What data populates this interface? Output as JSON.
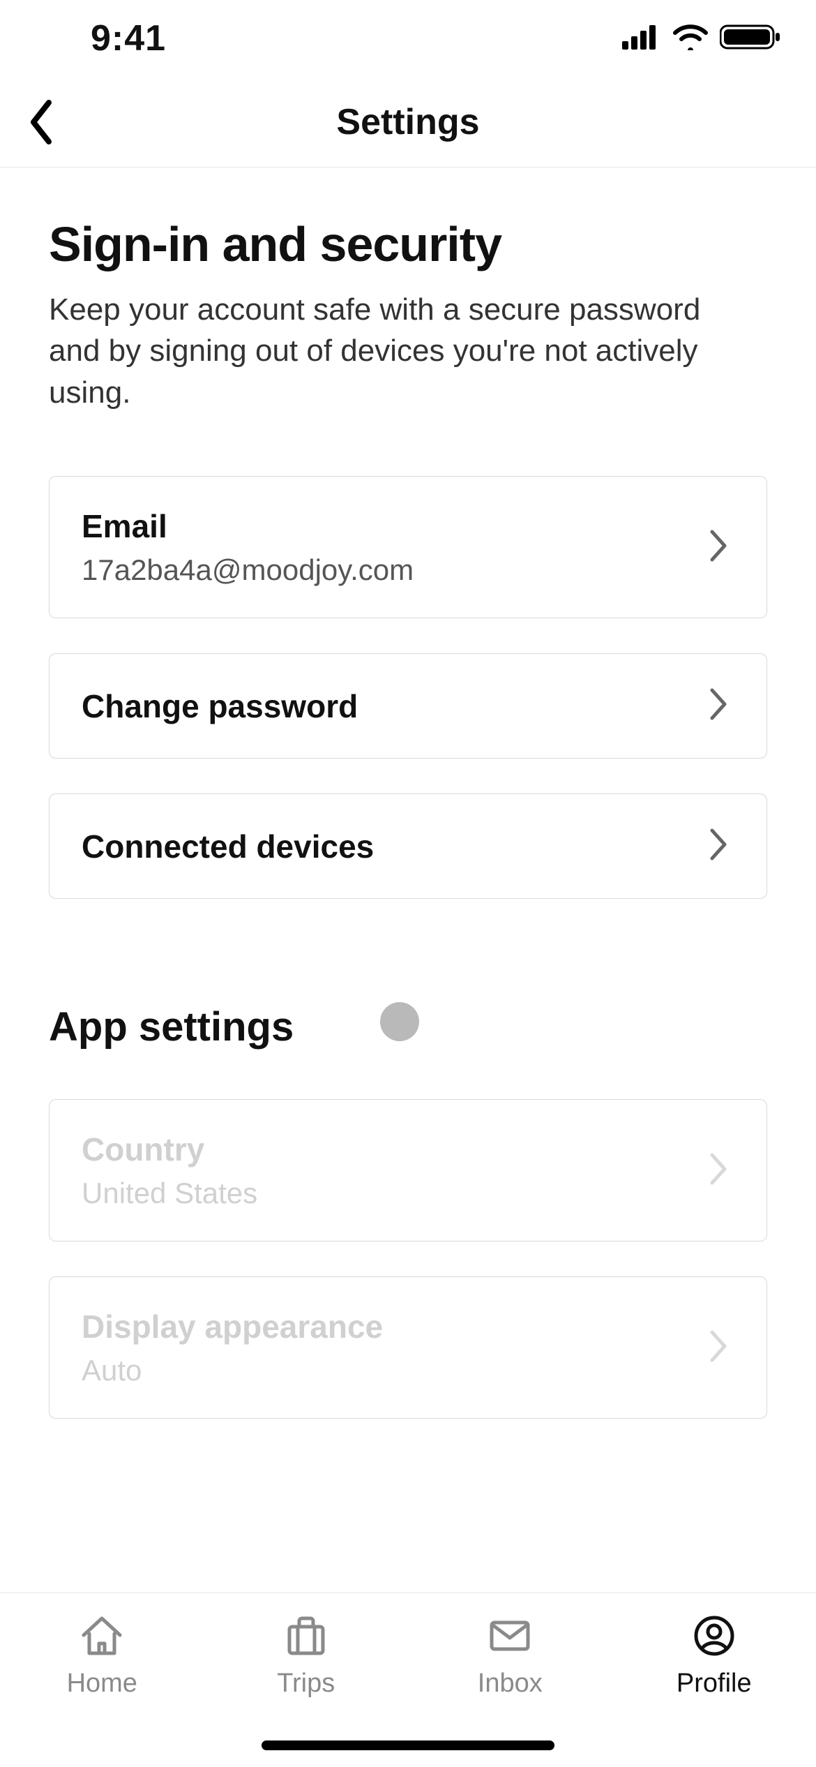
{
  "status": {
    "time": "9:41"
  },
  "header": {
    "title": "Settings"
  },
  "section1": {
    "title": "Sign-in and security",
    "description": "Keep your account safe with a secure password and by signing out of devices you're not actively using."
  },
  "cards": {
    "email": {
      "title": "Email",
      "value": "17a2ba4a@moodjoy.com"
    },
    "password": {
      "title": "Change password"
    },
    "devices": {
      "title": "Connected devices"
    }
  },
  "section2": {
    "title": "App settings"
  },
  "app_cards": {
    "country": {
      "title": "Country",
      "value": "United States"
    },
    "display": {
      "title": "Display appearance",
      "value": "Auto"
    }
  },
  "tabs": {
    "home": "Home",
    "trips": "Trips",
    "inbox": "Inbox",
    "profile": "Profile"
  }
}
